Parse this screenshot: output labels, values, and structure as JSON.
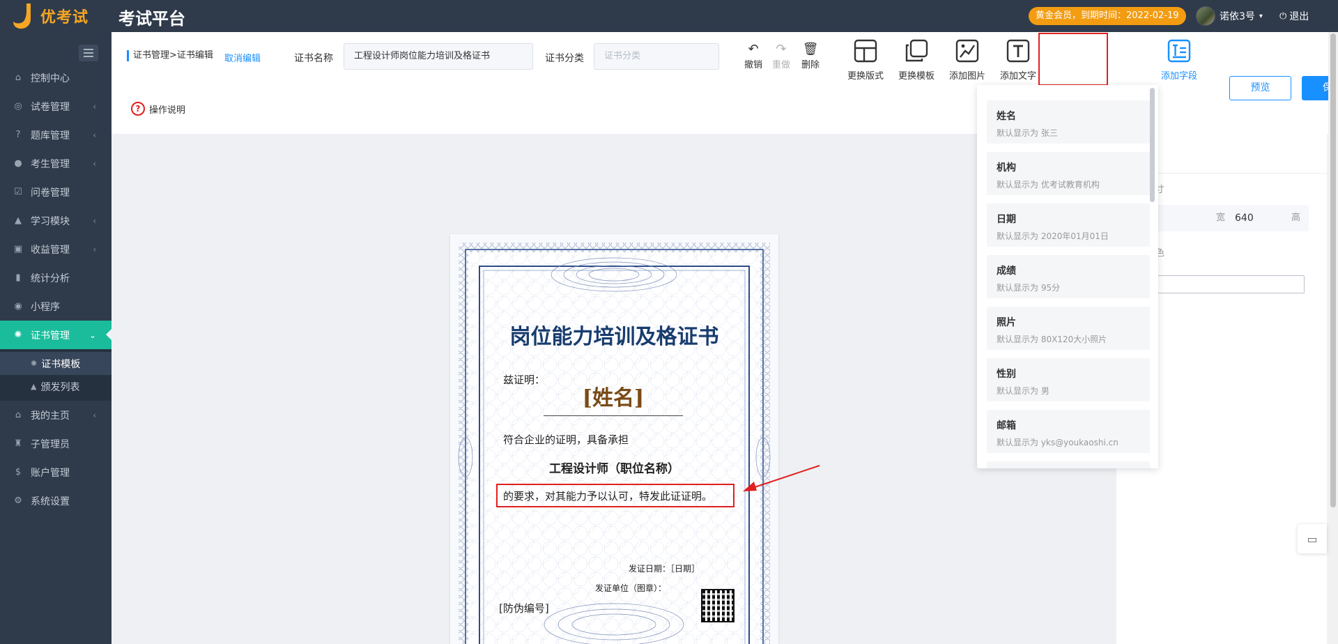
{
  "header": {
    "logo_text": "优考试",
    "platform_title": "考试平台",
    "member_badge": "黄金会员，到期时间：2022-02-19",
    "username": "诺依3号",
    "logout_label": "退出"
  },
  "sidebar": {
    "items": [
      {
        "label": "控制中心",
        "icon": "home-icon"
      },
      {
        "label": "试卷管理",
        "icon": "check-circle-icon"
      },
      {
        "label": "题库管理",
        "icon": "question-circle-icon"
      },
      {
        "label": "考生管理",
        "icon": "user-icon"
      },
      {
        "label": "问卷管理",
        "icon": "checkbox-icon"
      },
      {
        "label": "学习模块",
        "icon": "graduation-cap-icon"
      },
      {
        "label": "收益管理",
        "icon": "money-icon"
      },
      {
        "label": "统计分析",
        "icon": "bar-chart-icon"
      },
      {
        "label": "小程序",
        "icon": "wechat-icon"
      },
      {
        "label": "证书管理",
        "icon": "certificate-icon"
      },
      {
        "label": "我的主页",
        "icon": "home-user-icon"
      },
      {
        "label": "子管理员",
        "icon": "sub-admin-icon"
      },
      {
        "label": "账户管理",
        "icon": "dollar-icon"
      },
      {
        "label": "系统设置",
        "icon": "gear-icon"
      }
    ],
    "sub_items": [
      {
        "label": "证书模板"
      },
      {
        "label": "颁发列表"
      }
    ]
  },
  "toolbar": {
    "breadcrumb": "证书管理>证书编辑",
    "cancel_edit": "取消编辑",
    "cert_name_label": "证书名称",
    "cert_name_value": "工程设计师岗位能力培训及格证书",
    "cert_category_label": "证书分类",
    "cert_category_placeholder": "证书分类",
    "undo": "撤销",
    "redo": "重做",
    "delete": "删除",
    "change_layout": "更换版式",
    "change_template": "更换模板",
    "add_image": "添加图片",
    "add_text": "添加文字",
    "add_field": "添加字段",
    "preview": "预览",
    "save": "保存",
    "help": "操作说明"
  },
  "certificate": {
    "title": "岗位能力培训及格证书",
    "hereby": "兹证明：",
    "name": "[姓名]",
    "line1": "符合企业的证明，具备承担",
    "job": "工程设计师（职位名称）",
    "line2": "的要求，对其能力予以认可，特发此证证明。",
    "issue_date": "发证日期：［日期］",
    "issuer": "发证单位（图章）：",
    "serial": "[防伪编号]"
  },
  "properties": {
    "size_label_partial": "寸",
    "width_unit": "宽",
    "height_value": "640",
    "height_unit": "高",
    "color_label_partial": "色"
  },
  "field_dropdown": [
    {
      "title": "姓名",
      "desc": "默认显示为 张三"
    },
    {
      "title": "机构",
      "desc": "默认显示为 优考试教育机构"
    },
    {
      "title": "日期",
      "desc": "默认显示为 2020年01月01日"
    },
    {
      "title": "成绩",
      "desc": "默认显示为 95分"
    },
    {
      "title": "照片",
      "desc": "默认显示为 80X120大小照片"
    },
    {
      "title": "性别",
      "desc": "默认显示为 男"
    },
    {
      "title": "邮箱",
      "desc": "默认显示为 yks@youkaoshi.cn"
    }
  ],
  "colors": {
    "sidebar_bg": "#2f3b4b",
    "accent_active": "#1abc9c",
    "primary": "#1890ff",
    "badge": "#f39c12",
    "highlight_red": "#e0201f",
    "cert_title": "#183c6e",
    "cert_name": "#7a4a16"
  }
}
